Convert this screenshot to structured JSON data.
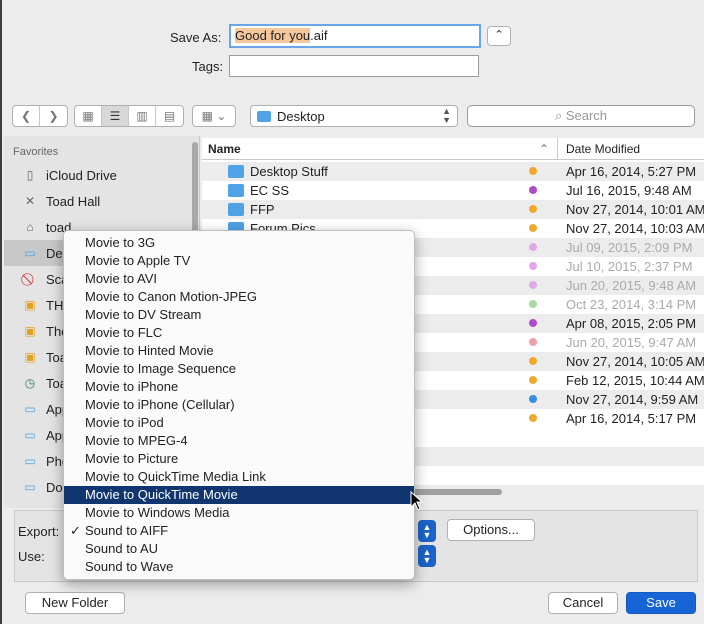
{
  "save_as": {
    "label": "Save As:",
    "filename_highlight": "Good for you",
    "filename_ext": ".aif"
  },
  "tags": {
    "label": "Tags:",
    "value": ""
  },
  "toolbar": {
    "back_icon": "chevron-left-icon",
    "forward_icon": "chevron-right-icon",
    "location": "Desktop",
    "search_placeholder": "Search"
  },
  "sidebar": {
    "heading": "Favorites",
    "items": [
      {
        "label": "iCloud Drive",
        "icon": "document-icon"
      },
      {
        "label": "Toad Hall",
        "icon": "applications-icon"
      },
      {
        "label": "toad",
        "icon": "home-icon"
      },
      {
        "label": "Desktop",
        "icon": "folder-icon",
        "visible": "Des"
      },
      {
        "label": "Sca",
        "icon": "no-entry-icon"
      },
      {
        "label": "TH",
        "icon": "disk-icon"
      },
      {
        "label": "The",
        "icon": "disk-icon"
      },
      {
        "label": "Toa",
        "icon": "disk-icon"
      },
      {
        "label": "Toa",
        "icon": "timemachine-icon"
      },
      {
        "label": "App",
        "icon": "folder-icon"
      },
      {
        "label": "App",
        "icon": "folder-icon"
      },
      {
        "label": "Pho",
        "icon": "folder-icon"
      },
      {
        "label": "Doc",
        "icon": "folder-icon"
      }
    ]
  },
  "file_list": {
    "col_name": "Name",
    "col_date": "Date Modified",
    "rows": [
      {
        "name": "Desktop Stuff",
        "date": "Apr 16, 2014, 5:27 PM",
        "tag": "#f0a830",
        "dim": false
      },
      {
        "name": "EC SS",
        "date": "Jul 16, 2015, 9:48 AM",
        "tag": "#b04cc8",
        "dim": false
      },
      {
        "name": "FFP",
        "date": "Nov 27, 2014, 10:01 AM",
        "tag": "#f0a830",
        "dim": false
      },
      {
        "name": "Forum Pics",
        "date": "Nov 27, 2014, 10:03 AM",
        "tag": "#f0a830",
        "dim": false
      },
      {
        "name": "",
        "date": "Jul 09, 2015, 2:09 PM",
        "tag": "#e0a8e8",
        "dim": true
      },
      {
        "name": "",
        "date": "Jul 10, 2015, 2:37 PM",
        "tag": "#e0a8e8",
        "dim": true
      },
      {
        "name": "",
        "date": "Jun 20, 2015, 9:48 AM",
        "tag": "#e0a8e8",
        "dim": true
      },
      {
        "name": "",
        "date": "Oct 23, 2014, 3:14 PM",
        "tag": "#a8d8a0",
        "dim": true
      },
      {
        "name": "",
        "date": "Apr 08, 2015, 2:05 PM",
        "tag": "#b04cc8",
        "dim": false
      },
      {
        "name": "",
        "date": "Jun 20, 2015, 9:47 AM",
        "tag": "#f0a0a8",
        "dim": true
      },
      {
        "name": "",
        "date": "Nov 27, 2014, 10:05 AM",
        "tag": "#f0a830",
        "dim": false
      },
      {
        "name": "",
        "date": "Feb 12, 2015, 10:44 AM",
        "tag": "#f0a830",
        "dim": false
      },
      {
        "name": "",
        "date": "Nov 27, 2014, 9:59 AM",
        "tag": "#3a8ee0",
        "dim": false
      },
      {
        "name": "",
        "date": "Apr 16, 2014, 5:17 PM",
        "tag": "#f0a830",
        "dim": false
      }
    ]
  },
  "options_panel": {
    "export_label": "Export:",
    "use_label": "Use:",
    "options_button": "Options..."
  },
  "export_menu": {
    "items": [
      {
        "label": "Movie to 3G",
        "selected": false,
        "checked": false
      },
      {
        "label": "Movie to Apple TV",
        "selected": false,
        "checked": false
      },
      {
        "label": "Movie to AVI",
        "selected": false,
        "checked": false
      },
      {
        "label": "Movie to Canon Motion-JPEG",
        "selected": false,
        "checked": false
      },
      {
        "label": "Movie to DV Stream",
        "selected": false,
        "checked": false
      },
      {
        "label": "Movie to FLC",
        "selected": false,
        "checked": false
      },
      {
        "label": "Movie to Hinted Movie",
        "selected": false,
        "checked": false
      },
      {
        "label": "Movie to Image Sequence",
        "selected": false,
        "checked": false
      },
      {
        "label": "Movie to iPhone",
        "selected": false,
        "checked": false
      },
      {
        "label": "Movie to iPhone (Cellular)",
        "selected": false,
        "checked": false
      },
      {
        "label": "Movie to iPod",
        "selected": false,
        "checked": false
      },
      {
        "label": "Movie to MPEG-4",
        "selected": false,
        "checked": false
      },
      {
        "label": "Movie to Picture",
        "selected": false,
        "checked": false
      },
      {
        "label": "Movie to QuickTime Media Link",
        "selected": false,
        "checked": false
      },
      {
        "label": "Movie to QuickTime Movie",
        "selected": true,
        "checked": false
      },
      {
        "label": "Movie to Windows Media",
        "selected": false,
        "checked": false
      },
      {
        "label": "Sound to AIFF",
        "selected": false,
        "checked": true
      },
      {
        "label": "Sound to AU",
        "selected": false,
        "checked": false
      },
      {
        "label": "Sound to Wave",
        "selected": false,
        "checked": false
      }
    ],
    "check_glyph": "✓"
  },
  "footer": {
    "new_folder": "New Folder",
    "cancel": "Cancel",
    "save": "Save"
  }
}
